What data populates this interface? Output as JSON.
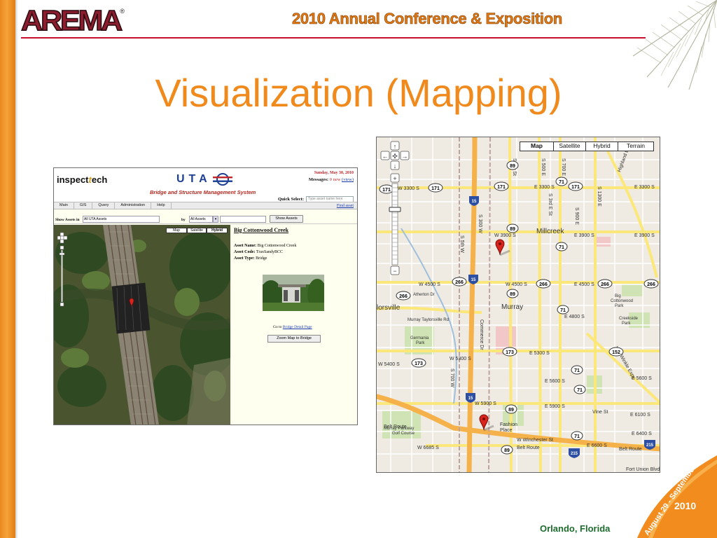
{
  "slide": {
    "logo_text": "AREMA",
    "logo_reg": "®",
    "conference_title": "2010 Annual Conference & Exposition",
    "title": "Visualization (Mapping)",
    "location": "Orlando, Florida",
    "corner_year": "2010",
    "corner_dates": "August 29 - September 1"
  },
  "app": {
    "brand_prefix": "inspect",
    "brand_t": "t",
    "brand_suffix": "ech",
    "uta": "UTA",
    "system_name": "Bridge and Structure Management System",
    "date": "Sunday, May 30, 2010",
    "messages_label": "Messages:",
    "messages_count": "0 new",
    "messages_link": "(view)",
    "quick_select_label": "Quick Select:",
    "quick_select_placeholder": "Type asset name here",
    "nav": [
      "Main",
      "GIS",
      "Query",
      "Administration",
      "Help"
    ],
    "find_asset": "Find asset",
    "show_assets_in_label": "Show Assets in",
    "assets_select_value": "All UTA Assets",
    "by_label": "by",
    "by_select_value": "All Assets",
    "show_assets_button": "Show Assets",
    "map_types": [
      "Map",
      "Satellite",
      "Hybrid"
    ],
    "asset_title": "Big Cottonwood Creek",
    "asset_name_label": "Asset Name:",
    "asset_name_value": "Big Cottonwood Creek",
    "asset_code_label": "Asset Code:",
    "asset_code_value": "TraxSandyBCC",
    "asset_type_label": "Asset Type:",
    "asset_type_value": "Bridge",
    "goto_prefix": "Go to",
    "goto_link": "Bridge Detail Page",
    "zoom_button": "Zoom Map to Bridge"
  },
  "gmap": {
    "map_types": [
      "Map",
      "Satellite",
      "Hybrid",
      "Terrain"
    ],
    "active_type": "Map",
    "places": [
      "Millcreek",
      "Murray",
      "lorsville",
      "Fashion Place",
      "Big Cottonwood Park",
      "Creekside Park",
      "Germania Park",
      "Murray Parkway Golf Course",
      "Fort Union Blvd"
    ],
    "streets": [
      "E 3300 S",
      "W 3300 S",
      "E 3900 S",
      "W 3900 S",
      "W 4500 S",
      "E 4500 S",
      "W 4500 S",
      "Atherton Dr",
      "Murray Taylorsville Rd",
      "E 4800 S",
      "E 5300 S",
      "W 5300 S",
      "W 5400 S",
      "E 5600 S",
      "E 5600 S",
      "W 5900 S",
      "E 5900 S",
      "E 6100 S",
      "Vine St",
      "E 6400 S",
      "Belt Route",
      "Belt Route",
      "W 6685 S",
      "W Winchester St",
      "E 6600 S",
      "State St",
      "S 500 E",
      "S 700 E",
      "S 900 E",
      "S 1300 E",
      "Highland Dr",
      "S 300 W",
      "S 700 W",
      "Commerce Dr",
      "Van Winkle Expy",
      "S 5th W",
      "S 3rd E St"
    ],
    "shields": [
      "171",
      "171",
      "171",
      "171",
      "89",
      "71",
      "71",
      "89",
      "71",
      "266",
      "266",
      "266",
      "266",
      "266",
      "89",
      "71",
      "173",
      "173",
      "152",
      "71",
      "89",
      "71",
      "89"
    ],
    "interstates": [
      "15",
      "15",
      "15",
      "215",
      "215"
    ]
  },
  "colors": {
    "orange": "#f08a1c",
    "header_orange": "#e47a12",
    "red_rule": "#c8102e",
    "location_green": "#1e6b2e",
    "map_yellow": "#fbe77a",
    "map_bg": "#efebe2"
  }
}
